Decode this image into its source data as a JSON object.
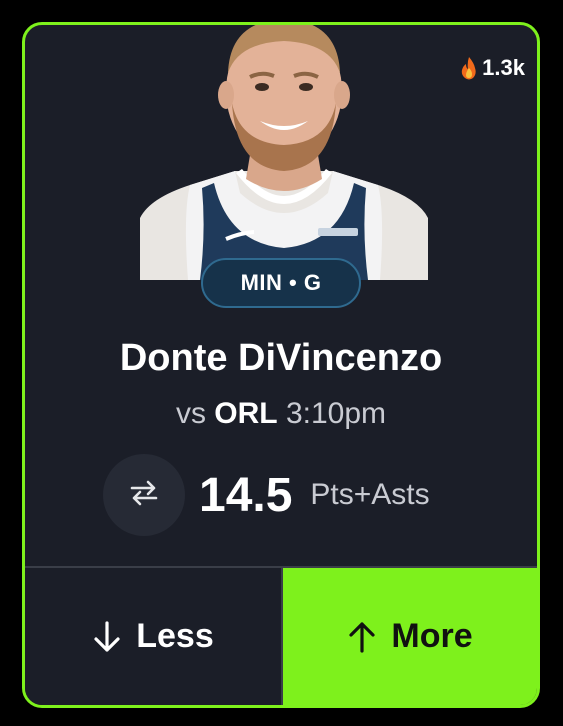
{
  "card": {
    "popularity": "1.3k",
    "popularity_icon": "fire-icon",
    "player_photo_icon": "player-headshot",
    "team_badge": "MIN • G",
    "player_name": "Donte DiVincenzo",
    "matchup": {
      "prefix": "vs",
      "opponent": "ORL",
      "time": "3:10pm"
    },
    "line": {
      "swap_icon": "swap-arrows-icon",
      "value": "14.5",
      "stat_type": "Pts+Asts"
    },
    "buttons": {
      "less_label": "Less",
      "less_icon": "arrow-down-icon",
      "more_label": "More",
      "more_icon": "arrow-up-icon"
    }
  },
  "colors": {
    "accent": "#7ef11c",
    "card_bg": "#1b1e28",
    "badge_bg": "#16324a",
    "page_bg": "#000000"
  }
}
